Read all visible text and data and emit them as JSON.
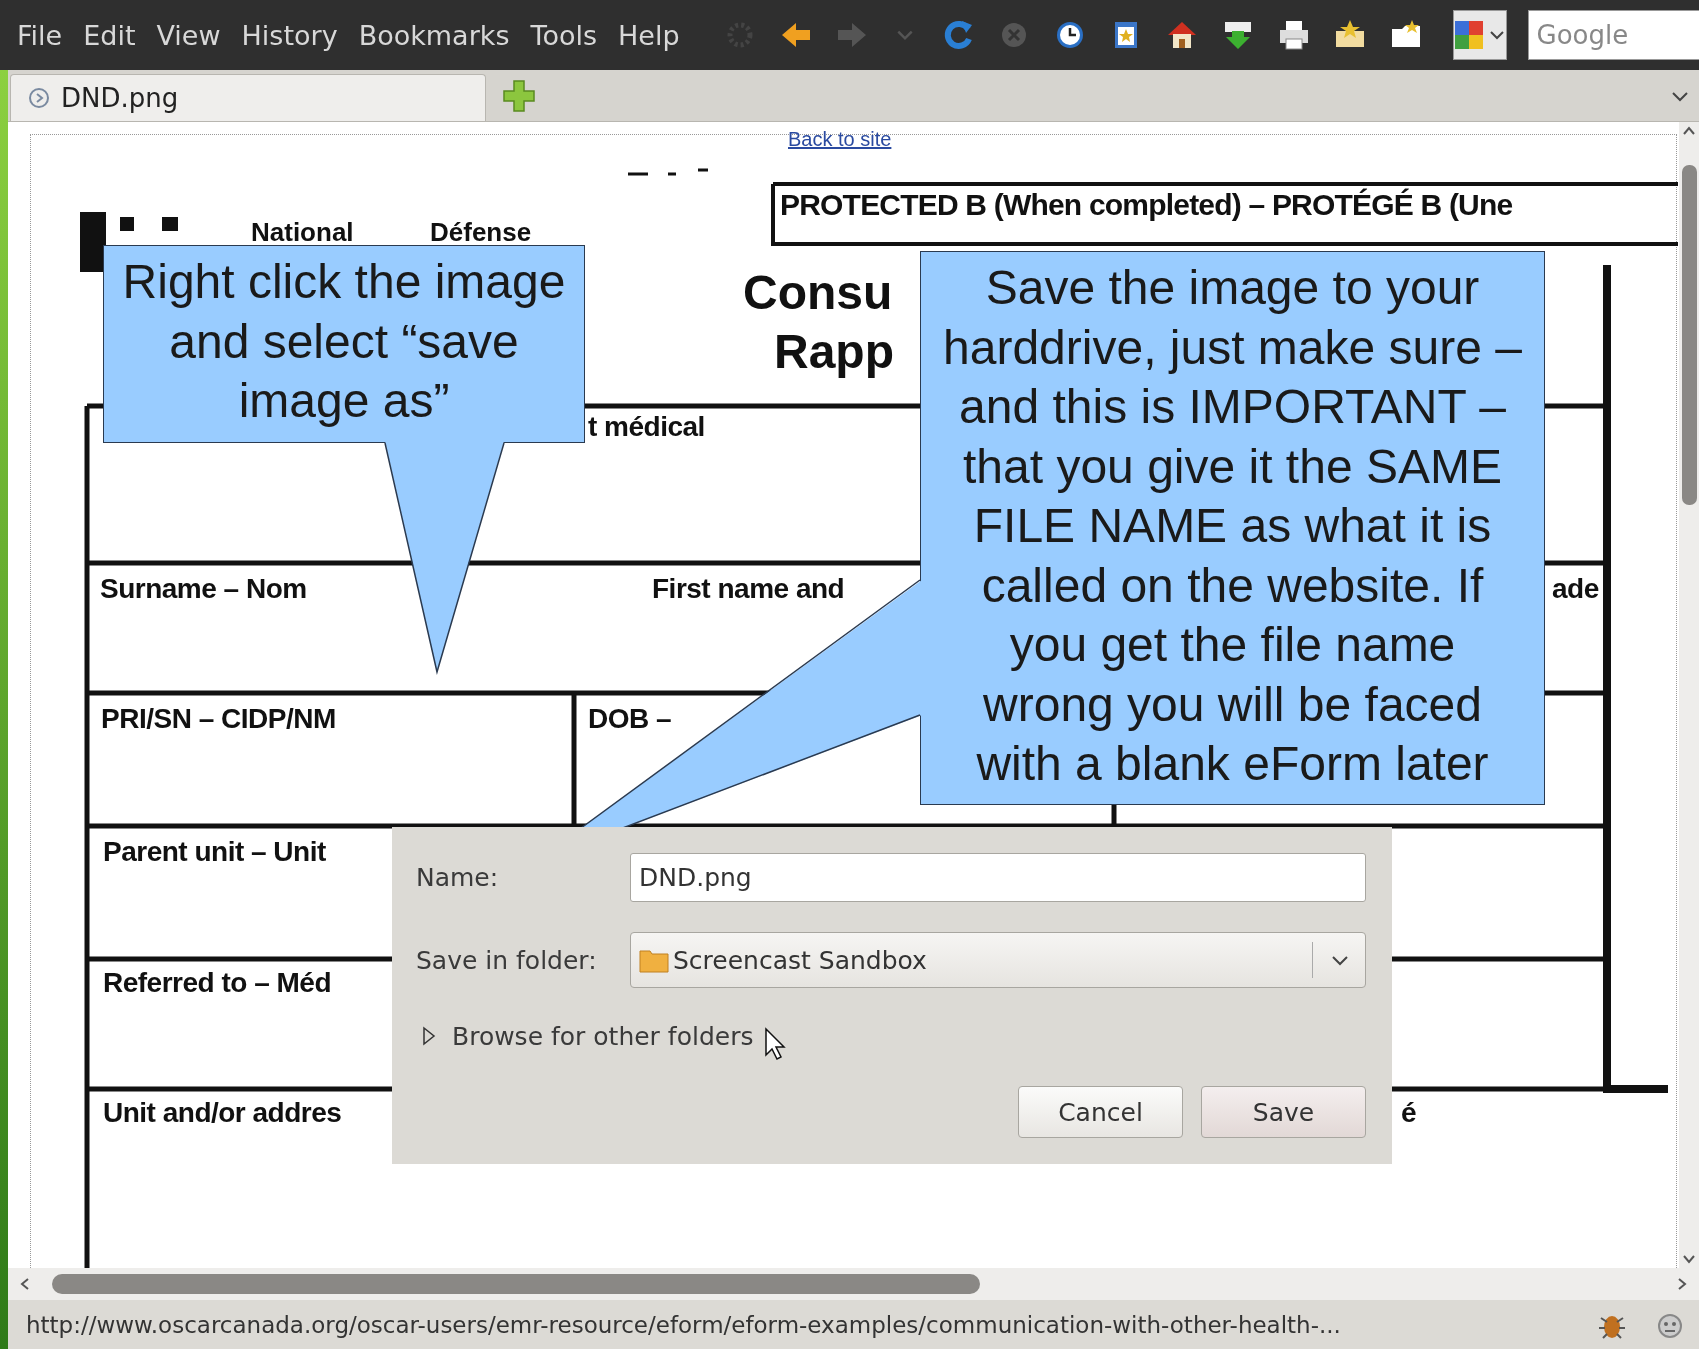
{
  "menu_bar": {
    "items": [
      "File",
      "Edit",
      "View",
      "History",
      "Bookmarks",
      "Tools",
      "Help"
    ]
  },
  "search": {
    "placeholder": "Google"
  },
  "tabs": [
    {
      "label": "DND.png",
      "selected": true
    }
  ],
  "page": {
    "back_link": "Back to site",
    "form_texts": [
      {
        "kind": "banner",
        "text": "PROTECTED B (When completed) – PROTÉGÉ B (Une"
      },
      {
        "kind": "small",
        "text": "National"
      },
      {
        "kind": "small",
        "text": "Défense"
      },
      {
        "kind": "title",
        "text": "Consu"
      },
      {
        "kind": "title",
        "text": "Rapp"
      },
      {
        "kind": "label",
        "text": "t médical"
      },
      {
        "kind": "label",
        "text": "Surname – Nom"
      },
      {
        "kind": "label",
        "text": "First name and"
      },
      {
        "kind": "label",
        "text": "ade"
      },
      {
        "kind": "label",
        "text": "PRI/SN – CIDP/NM"
      },
      {
        "kind": "label",
        "text": "DOB –"
      },
      {
        "kind": "label",
        "text": "Parent unit – Unit"
      },
      {
        "kind": "label",
        "text": "Referred to – Méd"
      },
      {
        "kind": "label",
        "text": "Unit and/or addres"
      },
      {
        "kind": "label",
        "text": "é"
      }
    ],
    "callouts": [
      "Right click the image and select “save image as”",
      "Save the image to your harddrive, just make sure – and this is IMPORTANT – that you give it the SAME FILE NAME as what it is called on the website. If you get the file name wrong you will be faced with a blank eForm later"
    ]
  },
  "save_dialog": {
    "name_label": "Name:",
    "name_value": "DND.png",
    "folder_label": "Save in folder:",
    "folder_value": "Screencast Sandbox",
    "browse_label": "Browse for other folders",
    "browse_expanded": false,
    "buttons": [
      "Cancel",
      "Save"
    ]
  },
  "status_bar": {
    "url": "http://www.oscarcanada.org/oscar-users/emr-resource/eform/eform-examples/communication-with-other-health-..."
  }
}
